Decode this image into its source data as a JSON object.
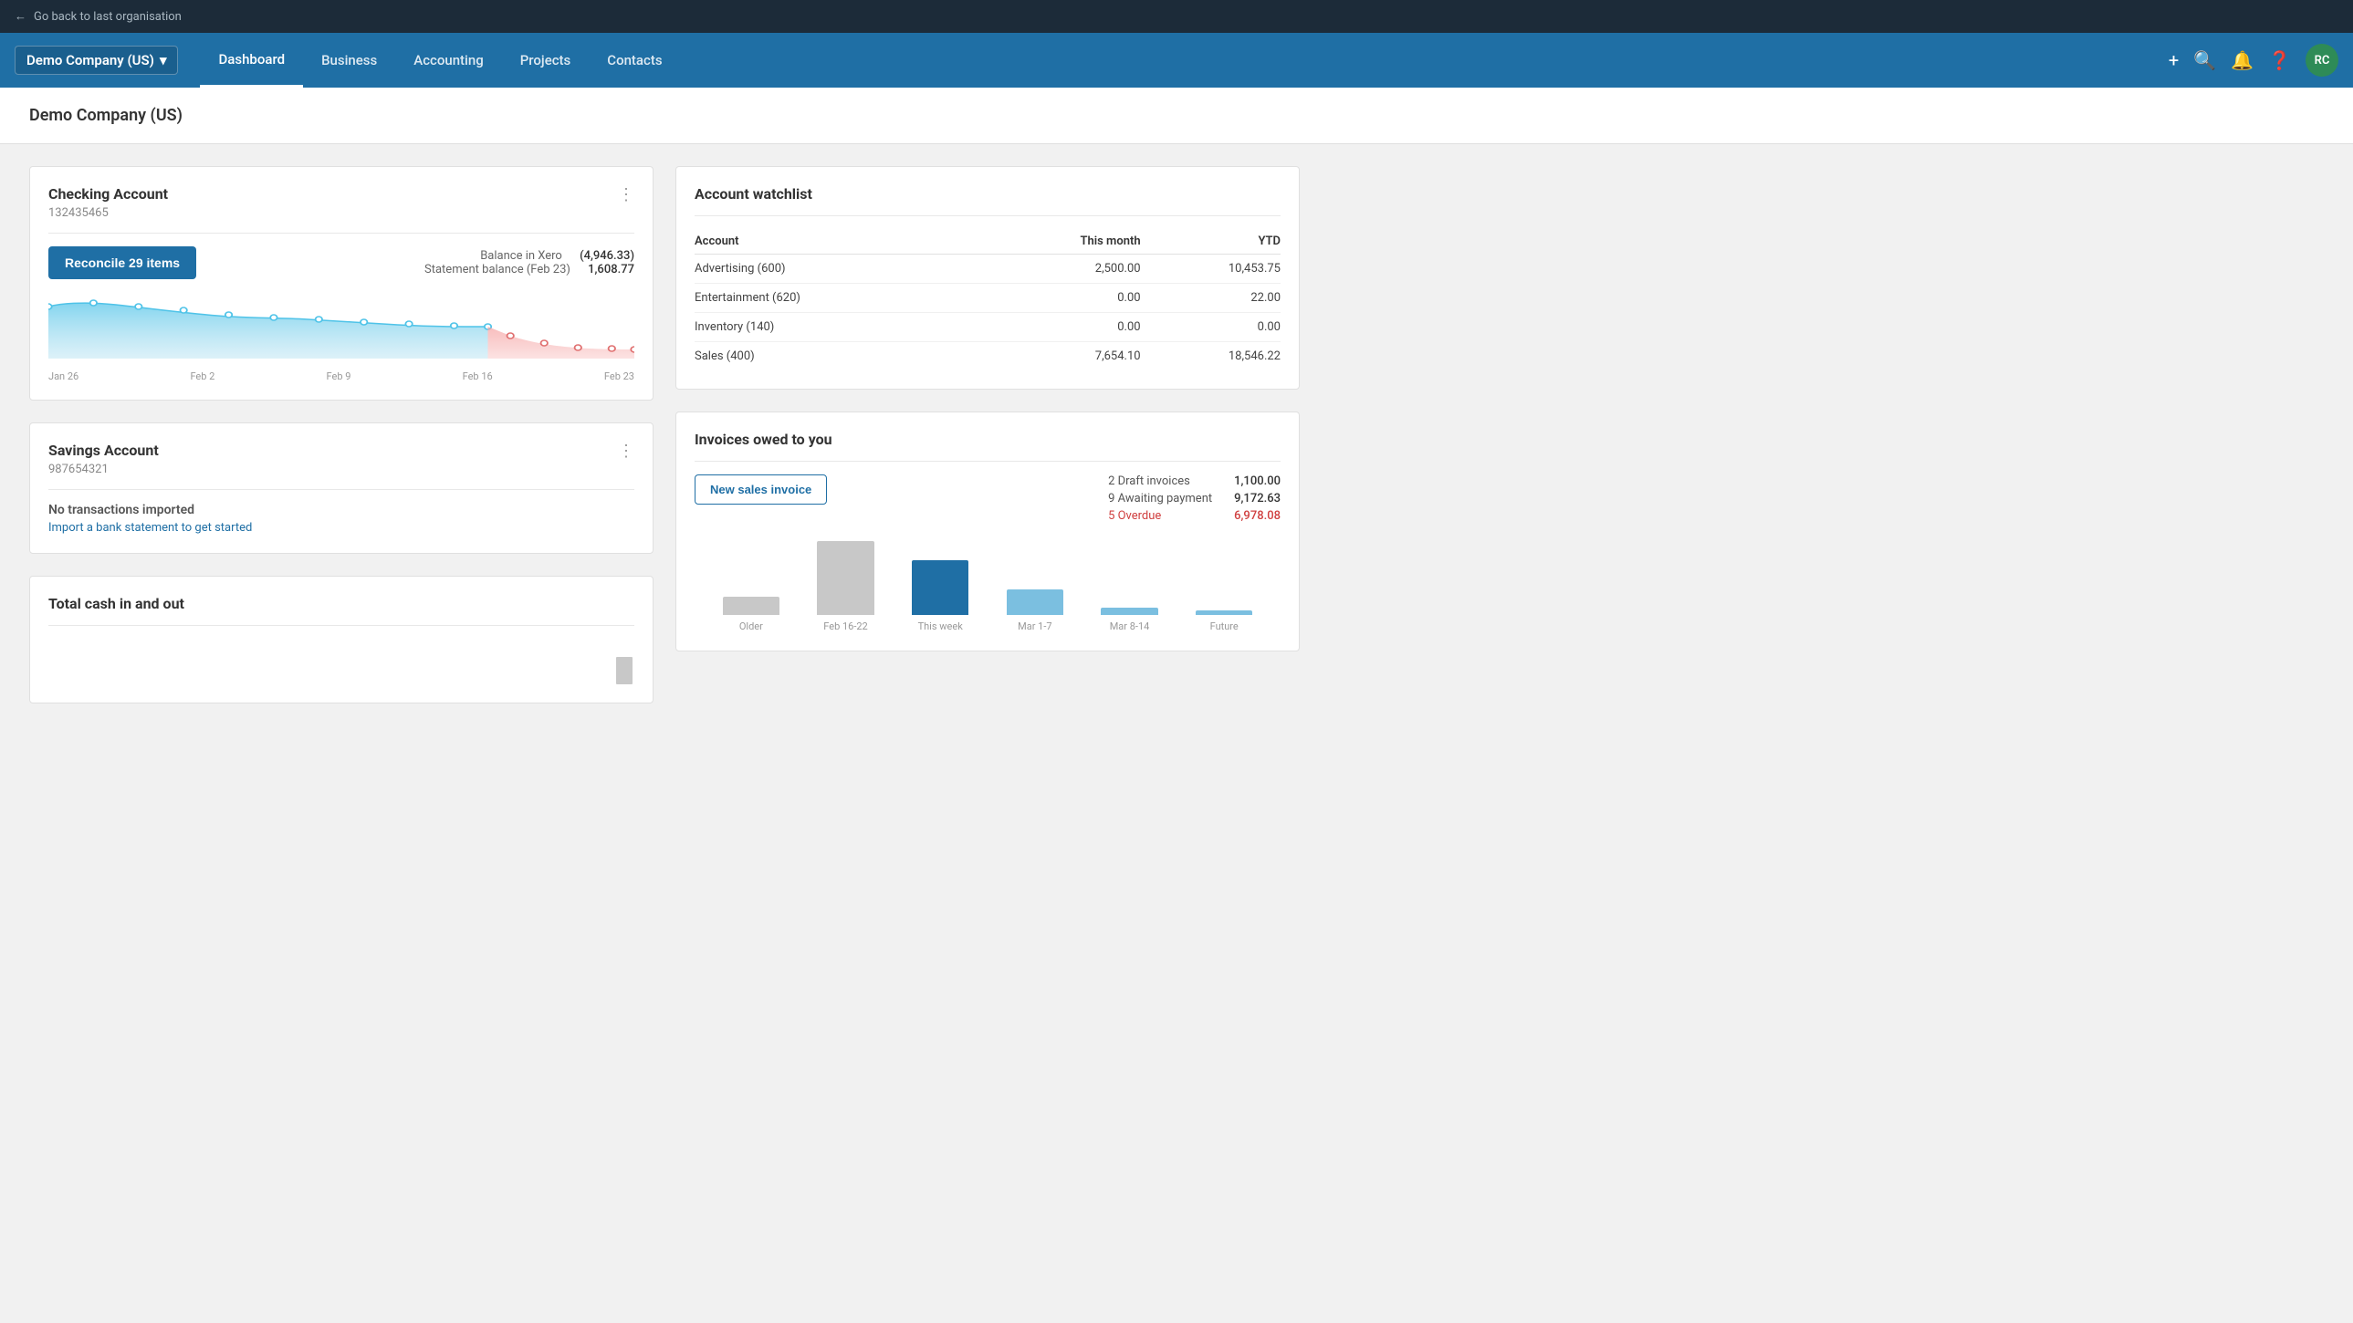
{
  "topbar": {
    "back_label": "Go back to last organisation"
  },
  "nav": {
    "org_name": "Demo Company (US)",
    "links": [
      {
        "label": "Dashboard",
        "active": true
      },
      {
        "label": "Business",
        "active": false
      },
      {
        "label": "Accounting",
        "active": false
      },
      {
        "label": "Projects",
        "active": false
      },
      {
        "label": "Contacts",
        "active": false
      }
    ],
    "avatar_initials": "RC"
  },
  "page_title": "Demo Company (US)",
  "checking_account": {
    "title": "Checking Account",
    "account_number": "132435465",
    "reconcile_btn": "Reconcile 29 items",
    "balance_label": "Balance in Xero",
    "balance_amount": "(4,946.33)",
    "statement_label": "Statement balance (Feb 23)",
    "statement_amount": "1,608.77",
    "chart_labels": [
      "Jan 26",
      "Feb 2",
      "Feb 9",
      "Feb 16",
      "Feb 23"
    ]
  },
  "savings_account": {
    "title": "Savings Account",
    "account_number": "987654321",
    "no_transactions": "No transactions imported",
    "import_link": "Import a bank statement to get started"
  },
  "total_cash": {
    "title": "Total cash in and out"
  },
  "watchlist": {
    "title": "Account watchlist",
    "col_account": "Account",
    "col_this_month": "This month",
    "col_ytd": "YTD",
    "rows": [
      {
        "account": "Advertising (600)",
        "this_month": "2,500.00",
        "ytd": "10,453.75"
      },
      {
        "account": "Entertainment (620)",
        "this_month": "0.00",
        "ytd": "22.00"
      },
      {
        "account": "Inventory (140)",
        "this_month": "0.00",
        "ytd": "0.00"
      },
      {
        "account": "Sales (400)",
        "this_month": "7,654.10",
        "ytd": "18,546.22"
      }
    ]
  },
  "invoices": {
    "title": "Invoices owed to you",
    "new_invoice_btn": "New sales invoice",
    "stats": [
      {
        "label": "2 Draft invoices",
        "amount": "1,100.00",
        "overdue": false
      },
      {
        "label": "9 Awaiting payment",
        "amount": "9,172.63",
        "overdue": false
      },
      {
        "label": "5 Overdue",
        "amount": "6,978.08",
        "overdue": true
      }
    ],
    "chart_bars": [
      {
        "label": "Older",
        "height": 20,
        "color": "#c8c8c8"
      },
      {
        "label": "Feb 16-22",
        "height": 85,
        "color": "#c8c8c8"
      },
      {
        "label": "This week",
        "height": 60,
        "color": "#1f6fa5"
      },
      {
        "label": "Mar 1-7",
        "height": 28,
        "color": "#7bbfe0"
      },
      {
        "label": "Mar 8-14",
        "height": 8,
        "color": "#7bbfe0"
      },
      {
        "label": "Future",
        "height": 5,
        "color": "#7bbfe0"
      }
    ]
  }
}
